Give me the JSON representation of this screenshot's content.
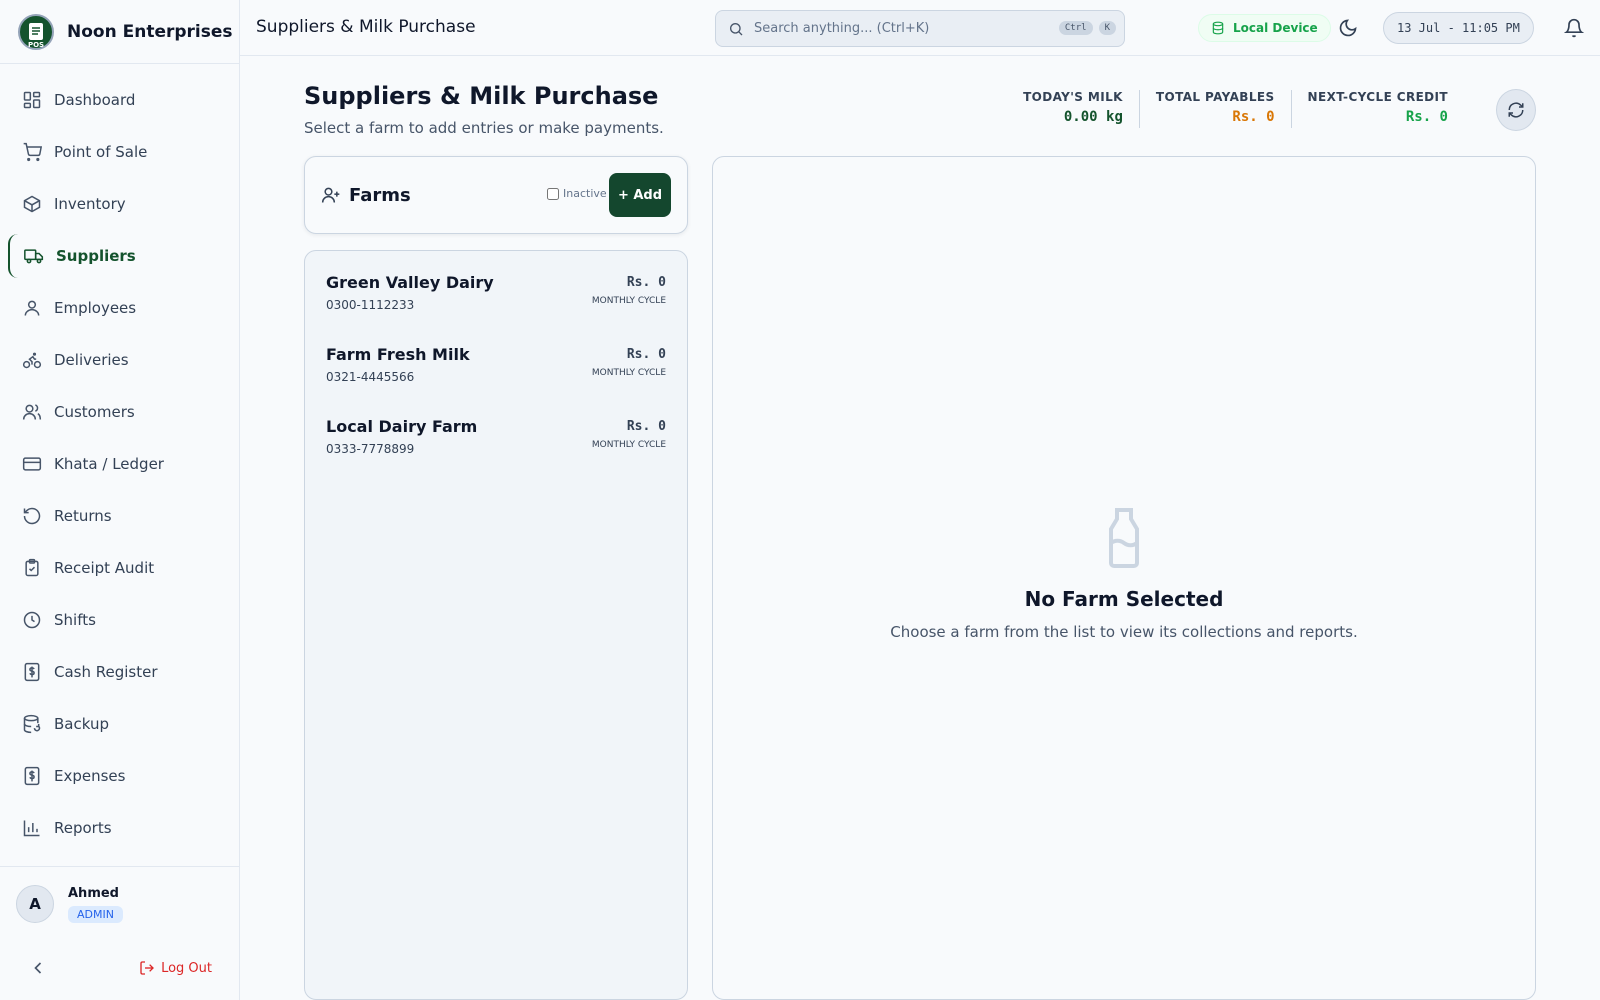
{
  "brand": {
    "name": "Noon Enterprises",
    "logo_text": "POS"
  },
  "sidebar": {
    "items": [
      {
        "label": "Dashboard",
        "icon": "dashboard-icon"
      },
      {
        "label": "Point of Sale",
        "icon": "cart-icon"
      },
      {
        "label": "Inventory",
        "icon": "box-icon"
      },
      {
        "label": "Suppliers",
        "icon": "truck-icon",
        "active": true
      },
      {
        "label": "Employees",
        "icon": "user-icon"
      },
      {
        "label": "Deliveries",
        "icon": "bike-icon"
      },
      {
        "label": "Customers",
        "icon": "users-icon"
      },
      {
        "label": "Khata / Ledger",
        "icon": "card-icon"
      },
      {
        "label": "Returns",
        "icon": "rotate-icon"
      },
      {
        "label": "Receipt Audit",
        "icon": "clipboard-check-icon"
      },
      {
        "label": "Shifts",
        "icon": "clock-icon"
      },
      {
        "label": "Cash Register",
        "icon": "dollar-receipt-icon"
      },
      {
        "label": "Backup",
        "icon": "database-icon"
      },
      {
        "label": "Expenses",
        "icon": "dollar-receipt-icon"
      },
      {
        "label": "Reports",
        "icon": "bar-chart-icon"
      }
    ],
    "user": {
      "initial": "A",
      "name": "Ahmed",
      "role": "ADMIN"
    },
    "logout_label": "Log Out"
  },
  "topbar": {
    "title": "Suppliers & Milk Purchase",
    "search_placeholder": "Search anything... (Ctrl+K)",
    "kbd": [
      "Ctrl",
      "K"
    ],
    "device": "Local Device",
    "datetime": "13 Jul - 11:05 PM"
  },
  "page": {
    "title": "Suppliers & Milk Purchase",
    "subtitle": "Select a farm to add entries or make payments.",
    "stats": [
      {
        "label": "TODAY'S MILK",
        "value": "0.00 kg",
        "color": "#14532d"
      },
      {
        "label": "TOTAL PAYABLES",
        "value": "Rs. 0",
        "color": "#d97706"
      },
      {
        "label": "NEXT-CYCLE CREDIT",
        "value": "Rs. 0",
        "color": "#16a34a"
      }
    ]
  },
  "farms": {
    "title": "Farms",
    "inactive_label": "Inactive",
    "inactive_checked": false,
    "add_label": "+ Add",
    "list": [
      {
        "name": "Green Valley Dairy",
        "phone": "0300-1112233",
        "amount": "Rs. 0",
        "cycle": "MONTHLY CYCLE"
      },
      {
        "name": "Farm Fresh Milk",
        "phone": "0321-4445566",
        "amount": "Rs. 0",
        "cycle": "MONTHLY CYCLE"
      },
      {
        "name": "Local Dairy Farm",
        "phone": "0333-7778899",
        "amount": "Rs. 0",
        "cycle": "MONTHLY CYCLE"
      }
    ]
  },
  "detail": {
    "empty_title": "No Farm Selected",
    "empty_subtitle": "Choose a farm from the list to view its collections and reports."
  }
}
